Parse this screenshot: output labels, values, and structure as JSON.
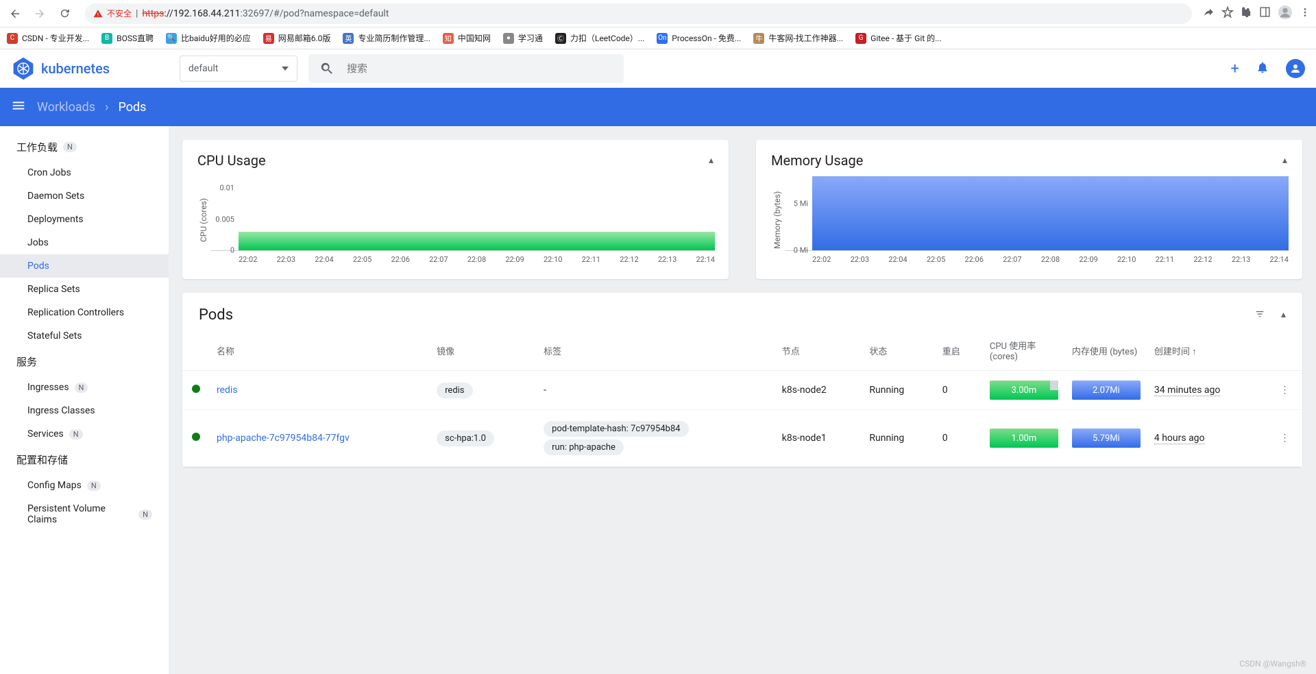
{
  "browser": {
    "danger_label": "不安全",
    "danger_sep": "|",
    "url_scheme": "https",
    "url_host": "://192.168.44.211",
    "url_rest": ":32697/#/pod?namespace=default",
    "bookmarks": [
      {
        "label": "CSDN - 专业开发...",
        "color": "#cf3e2d",
        "glyph": "C"
      },
      {
        "label": "BOSS直聘",
        "color": "#12b8a4",
        "glyph": "B"
      },
      {
        "label": "比baidu好用的必应",
        "color": "#3ca0e7",
        "glyph": "🔍"
      },
      {
        "label": "网易邮箱6.0版",
        "color": "#d32f2f",
        "glyph": "易"
      },
      {
        "label": "专业简历制作管理...",
        "color": "#4674c1",
        "glyph": "英"
      },
      {
        "label": "中国知网",
        "color": "#e36049",
        "glyph": "知"
      },
      {
        "label": "学习通",
        "color": "#888",
        "glyph": "●"
      },
      {
        "label": "力扣（LeetCode）...",
        "color": "#222",
        "glyph": "Ⓒ"
      },
      {
        "label": "ProcessOn - 免费...",
        "color": "#2f6df6",
        "glyph": "On"
      },
      {
        "label": "牛客网-找工作神器...",
        "color": "#b38b59",
        "glyph": "牛"
      },
      {
        "label": "Gitee - 基于 Git 的...",
        "color": "#c71d23",
        "glyph": "G"
      }
    ]
  },
  "header": {
    "logo_text": "kubernetes",
    "namespace": "default",
    "search_placeholder": "搜索"
  },
  "toolbar": {
    "crumb1": "Workloads",
    "crumb2": "Pods"
  },
  "sidebar": {
    "s1": {
      "title": "工作负载",
      "badge": "N"
    },
    "s1_items": [
      "Cron Jobs",
      "Daemon Sets",
      "Deployments",
      "Jobs",
      "Pods",
      "Replica Sets",
      "Replication Controllers",
      "Stateful Sets"
    ],
    "s2": {
      "title": "服务"
    },
    "s2_items": [
      {
        "label": "Ingresses",
        "badge": "N"
      },
      {
        "label": "Ingress Classes"
      },
      {
        "label": "Services",
        "badge": "N"
      }
    ],
    "s3": {
      "title": "配置和存储"
    },
    "s3_items": [
      {
        "label": "Config Maps",
        "badge": "N"
      },
      {
        "label": "Persistent Volume Claims",
        "badge": "N"
      }
    ]
  },
  "pods": {
    "title": "Pods",
    "cols": [
      "",
      "名称",
      "镜像",
      "标签",
      "节点",
      "状态",
      "重启",
      "CPU 使用率 (cores)",
      "内存使用 (bytes)",
      "创建时间 ↑",
      ""
    ],
    "rows": [
      {
        "name": "redis",
        "image": "redis",
        "labels": [
          "-"
        ],
        "node": "k8s-node2",
        "status": "Running",
        "restarts": "0",
        "cpu": "3.00m",
        "mem": "2.07Mi",
        "age": "34 minutes ago",
        "cpu_partial": true
      },
      {
        "name": "php-apache-7c97954b84-77fgv",
        "image": "sc-hpa:1.0",
        "labels": [
          "pod-template-hash: 7c97954b84",
          "run: php-apache"
        ],
        "node": "k8s-node1",
        "status": "Running",
        "restarts": "0",
        "cpu": "1.00m",
        "mem": "5.79Mi",
        "age": "4 hours ago",
        "cpu_partial": false
      }
    ]
  },
  "chart_data": [
    {
      "type": "area",
      "title": "CPU Usage",
      "ylabel": "CPU (cores)",
      "ylim": [
        0,
        0.012
      ],
      "yticks": [
        0,
        0.005,
        0.01
      ],
      "categories": [
        "22:02",
        "22:03",
        "22:04",
        "22:05",
        "22:06",
        "22:07",
        "22:08",
        "22:09",
        "22:10",
        "22:11",
        "22:12",
        "22:13",
        "22:14"
      ],
      "values": [
        0.003,
        0.003,
        0.003,
        0.003,
        0.003,
        0.003,
        0.003,
        0.003,
        0.003,
        0.003,
        0.003,
        0.003,
        0.003
      ],
      "color_top": "#9ae6a5",
      "color_bottom": "#00c752"
    },
    {
      "type": "area",
      "title": "Memory Usage",
      "ylabel": "Memory (bytes)",
      "ylim": [
        0,
        8
      ],
      "yticks_labels": [
        "0 Mi",
        "5 Mi"
      ],
      "yticks": [
        0,
        5
      ],
      "categories": [
        "22:02",
        "22:03",
        "22:04",
        "22:05",
        "22:06",
        "22:07",
        "22:08",
        "22:09",
        "22:10",
        "22:11",
        "22:12",
        "22:13",
        "22:14"
      ],
      "values": [
        7.9,
        7.9,
        7.9,
        7.9,
        7.9,
        7.9,
        7.9,
        7.9,
        7.9,
        7.9,
        7.9,
        7.9,
        7.9
      ],
      "color_top": "#8aa9f9",
      "color_bottom": "#326de6"
    }
  ],
  "watermark": "CSDN @Wangsh®"
}
